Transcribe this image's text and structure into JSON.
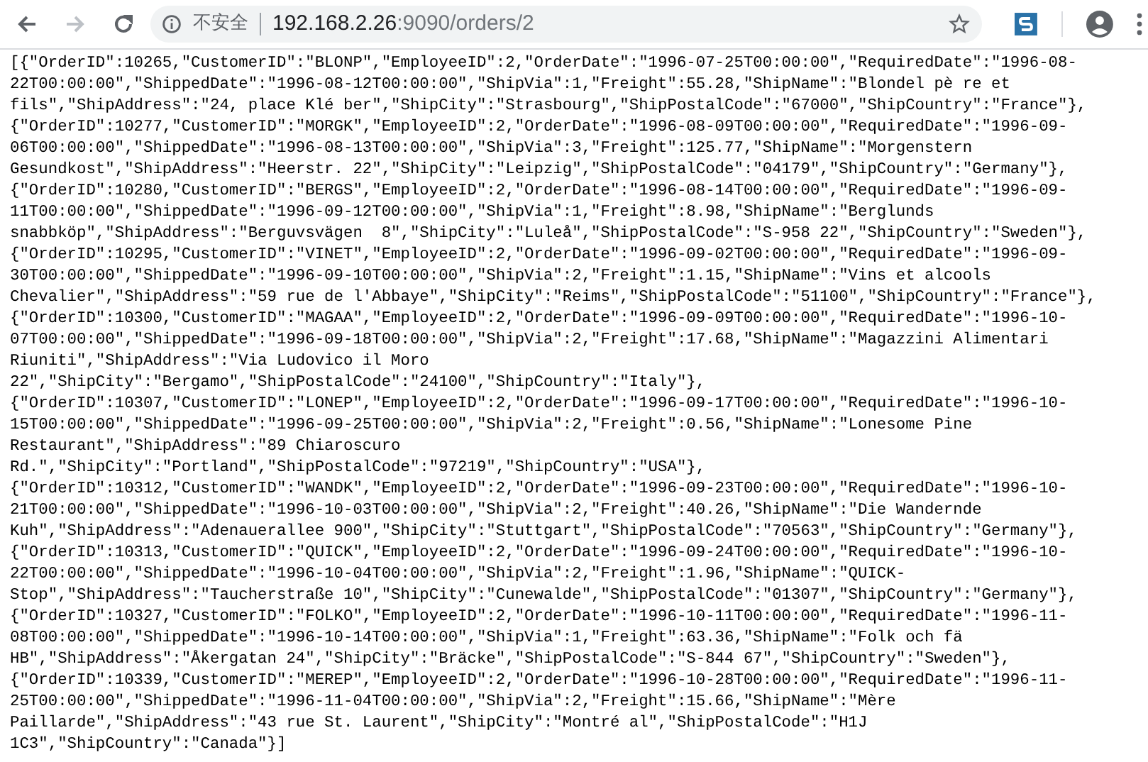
{
  "toolbar": {
    "nav_buttons": [
      {
        "kind": "back",
        "disabled": false
      },
      {
        "kind": "forward",
        "disabled": true
      },
      {
        "kind": "reload",
        "disabled": false
      }
    ],
    "security_label": "不安全",
    "url_host": "192.168.2.26",
    "url_path": ":9090/orders/2"
  },
  "body": {
    "lines": [
      "[{\"OrderID\":10265,\"CustomerID\":\"BLONP\",\"EmployeeID\":2,\"OrderDate\":\"1996-07-25T00:00:00\",\"RequiredDate\":\"1996-08-",
      "22T00:00:00\",\"ShippedDate\":\"1996-08-12T00:00:00\",\"ShipVia\":1,\"Freight\":55.28,\"ShipName\":\"Blondel pè re et",
      "fils\",\"ShipAddress\":\"24, place Klé ber\",\"ShipCity\":\"Strasbourg\",\"ShipPostalCode\":\"67000\",\"ShipCountry\":\"France\"},",
      "{\"OrderID\":10277,\"CustomerID\":\"MORGK\",\"EmployeeID\":2,\"OrderDate\":\"1996-08-09T00:00:00\",\"RequiredDate\":\"1996-09-",
      "06T00:00:00\",\"ShippedDate\":\"1996-08-13T00:00:00\",\"ShipVia\":3,\"Freight\":125.77,\"ShipName\":\"Morgenstern",
      "Gesundkost\",\"ShipAddress\":\"Heerstr. 22\",\"ShipCity\":\"Leipzig\",\"ShipPostalCode\":\"04179\",\"ShipCountry\":\"Germany\"},",
      "{\"OrderID\":10280,\"CustomerID\":\"BERGS\",\"EmployeeID\":2,\"OrderDate\":\"1996-08-14T00:00:00\",\"RequiredDate\":\"1996-09-",
      "11T00:00:00\",\"ShippedDate\":\"1996-09-12T00:00:00\",\"ShipVia\":1,\"Freight\":8.98,\"ShipName\":\"Berglunds",
      "snabbköp\",\"ShipAddress\":\"Berguvsvägen  8\",\"ShipCity\":\"Luleå\",\"ShipPostalCode\":\"S-958 22\",\"ShipCountry\":\"Sweden\"},",
      "{\"OrderID\":10295,\"CustomerID\":\"VINET\",\"EmployeeID\":2,\"OrderDate\":\"1996-09-02T00:00:00\",\"RequiredDate\":\"1996-09-",
      "30T00:00:00\",\"ShippedDate\":\"1996-09-10T00:00:00\",\"ShipVia\":2,\"Freight\":1.15,\"ShipName\":\"Vins et alcools",
      "Chevalier\",\"ShipAddress\":\"59 rue de l'Abbaye\",\"ShipCity\":\"Reims\",\"ShipPostalCode\":\"51100\",\"ShipCountry\":\"France\"},",
      "{\"OrderID\":10300,\"CustomerID\":\"MAGAA\",\"EmployeeID\":2,\"OrderDate\":\"1996-09-09T00:00:00\",\"RequiredDate\":\"1996-10-",
      "07T00:00:00\",\"ShippedDate\":\"1996-09-18T00:00:00\",\"ShipVia\":2,\"Freight\":17.68,\"ShipName\":\"Magazzini Alimentari",
      "Riuniti\",\"ShipAddress\":\"Via Ludovico il Moro",
      "22\",\"ShipCity\":\"Bergamo\",\"ShipPostalCode\":\"24100\",\"ShipCountry\":\"Italy\"},",
      "{\"OrderID\":10307,\"CustomerID\":\"LONEP\",\"EmployeeID\":2,\"OrderDate\":\"1996-09-17T00:00:00\",\"RequiredDate\":\"1996-10-",
      "15T00:00:00\",\"ShippedDate\":\"1996-09-25T00:00:00\",\"ShipVia\":2,\"Freight\":0.56,\"ShipName\":\"Lonesome Pine",
      "Restaurant\",\"ShipAddress\":\"89 Chiaroscuro",
      "Rd.\",\"ShipCity\":\"Portland\",\"ShipPostalCode\":\"97219\",\"ShipCountry\":\"USA\"},",
      "{\"OrderID\":10312,\"CustomerID\":\"WANDK\",\"EmployeeID\":2,\"OrderDate\":\"1996-09-23T00:00:00\",\"RequiredDate\":\"1996-10-",
      "21T00:00:00\",\"ShippedDate\":\"1996-10-03T00:00:00\",\"ShipVia\":2,\"Freight\":40.26,\"ShipName\":\"Die Wandernde",
      "Kuh\",\"ShipAddress\":\"Adenauerallee 900\",\"ShipCity\":\"Stuttgart\",\"ShipPostalCode\":\"70563\",\"ShipCountry\":\"Germany\"},",
      "{\"OrderID\":10313,\"CustomerID\":\"QUICK\",\"EmployeeID\":2,\"OrderDate\":\"1996-09-24T00:00:00\",\"RequiredDate\":\"1996-10-",
      "22T00:00:00\",\"ShippedDate\":\"1996-10-04T00:00:00\",\"ShipVia\":2,\"Freight\":1.96,\"ShipName\":\"QUICK-",
      "Stop\",\"ShipAddress\":\"Taucherstraße 10\",\"ShipCity\":\"Cunewalde\",\"ShipPostalCode\":\"01307\",\"ShipCountry\":\"Germany\"},",
      "{\"OrderID\":10327,\"CustomerID\":\"FOLKO\",\"EmployeeID\":2,\"OrderDate\":\"1996-10-11T00:00:00\",\"RequiredDate\":\"1996-11-",
      "08T00:00:00\",\"ShippedDate\":\"1996-10-14T00:00:00\",\"ShipVia\":1,\"Freight\":63.36,\"ShipName\":\"Folk och fä",
      "HB\",\"ShipAddress\":\"Åkergatan 24\",\"ShipCity\":\"Bräcke\",\"ShipPostalCode\":\"S-844 67\",\"ShipCountry\":\"Sweden\"},",
      "{\"OrderID\":10339,\"CustomerID\":\"MEREP\",\"EmployeeID\":2,\"OrderDate\":\"1996-10-28T00:00:00\",\"RequiredDate\":\"1996-11-",
      "25T00:00:00\",\"ShippedDate\":\"1996-11-04T00:00:00\",\"ShipVia\":2,\"Freight\":15.66,\"ShipName\":\"Mère",
      "Paillarde\",\"ShipAddress\":\"43 rue St. Laurent\",\"ShipCity\":\"Montré al\",\"ShipPostalCode\":\"H1J",
      "1C3\",\"ShipCountry\":\"Canada\"}]"
    ]
  }
}
